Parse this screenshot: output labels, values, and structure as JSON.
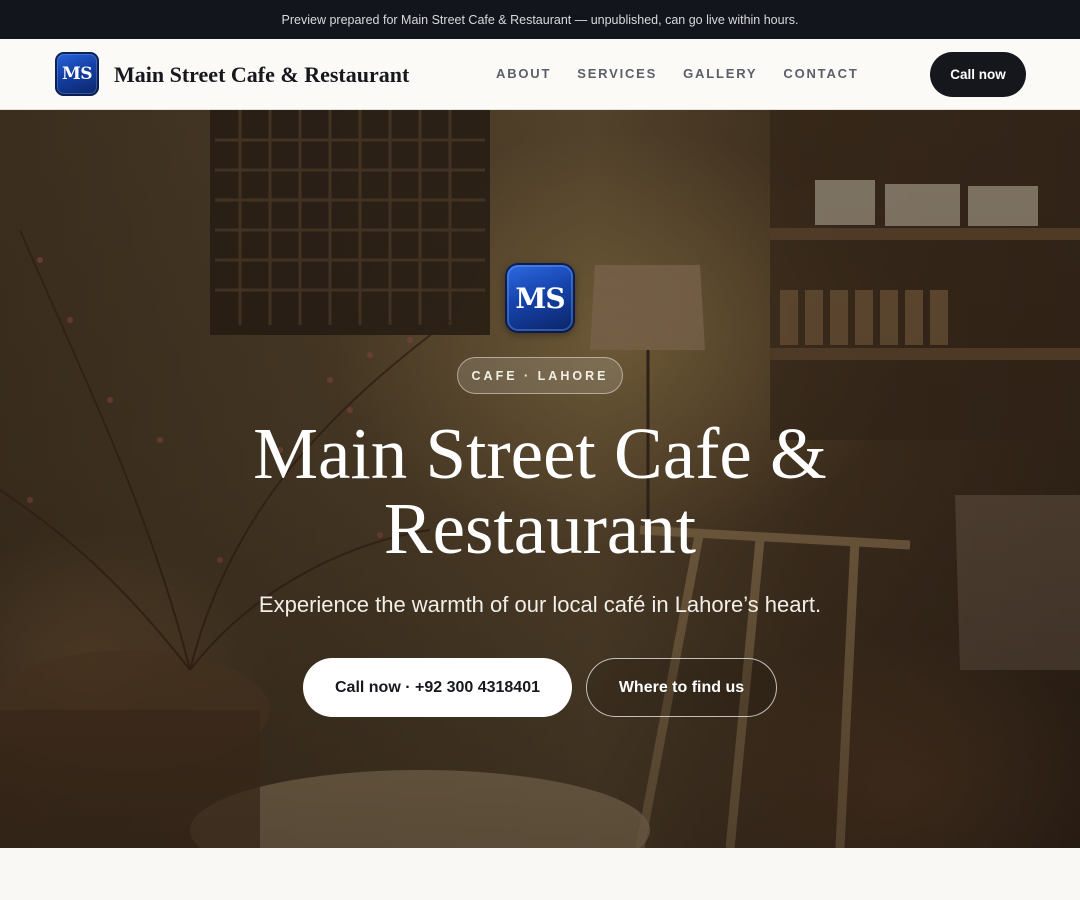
{
  "banner": {
    "text": "Preview prepared for Main Street Cafe & Restaurant — unpublished, can go live within hours."
  },
  "nav": {
    "logo_text": "MS",
    "brand": "Main Street Cafe & Restaurant",
    "links": [
      "ABOUT",
      "SERVICES",
      "GALLERY",
      "CONTACT"
    ],
    "cta": "Call now"
  },
  "hero": {
    "logo_text": "MS",
    "tag": "CAFE · LAHORE",
    "title": "Main Street Cafe & Restaurant",
    "subtitle": "Experience the warmth of our local café in Lahore’s heart.",
    "primary_button": "Call now · +92 300 4318401",
    "secondary_button": "Where to find us",
    "background_image": "cafe-interior-photo"
  },
  "colors": {
    "banner_bg": "#12151b",
    "dark_button": "#15171c",
    "logo_blue": "#1644ad",
    "page_bg": "#f9f8f5"
  }
}
